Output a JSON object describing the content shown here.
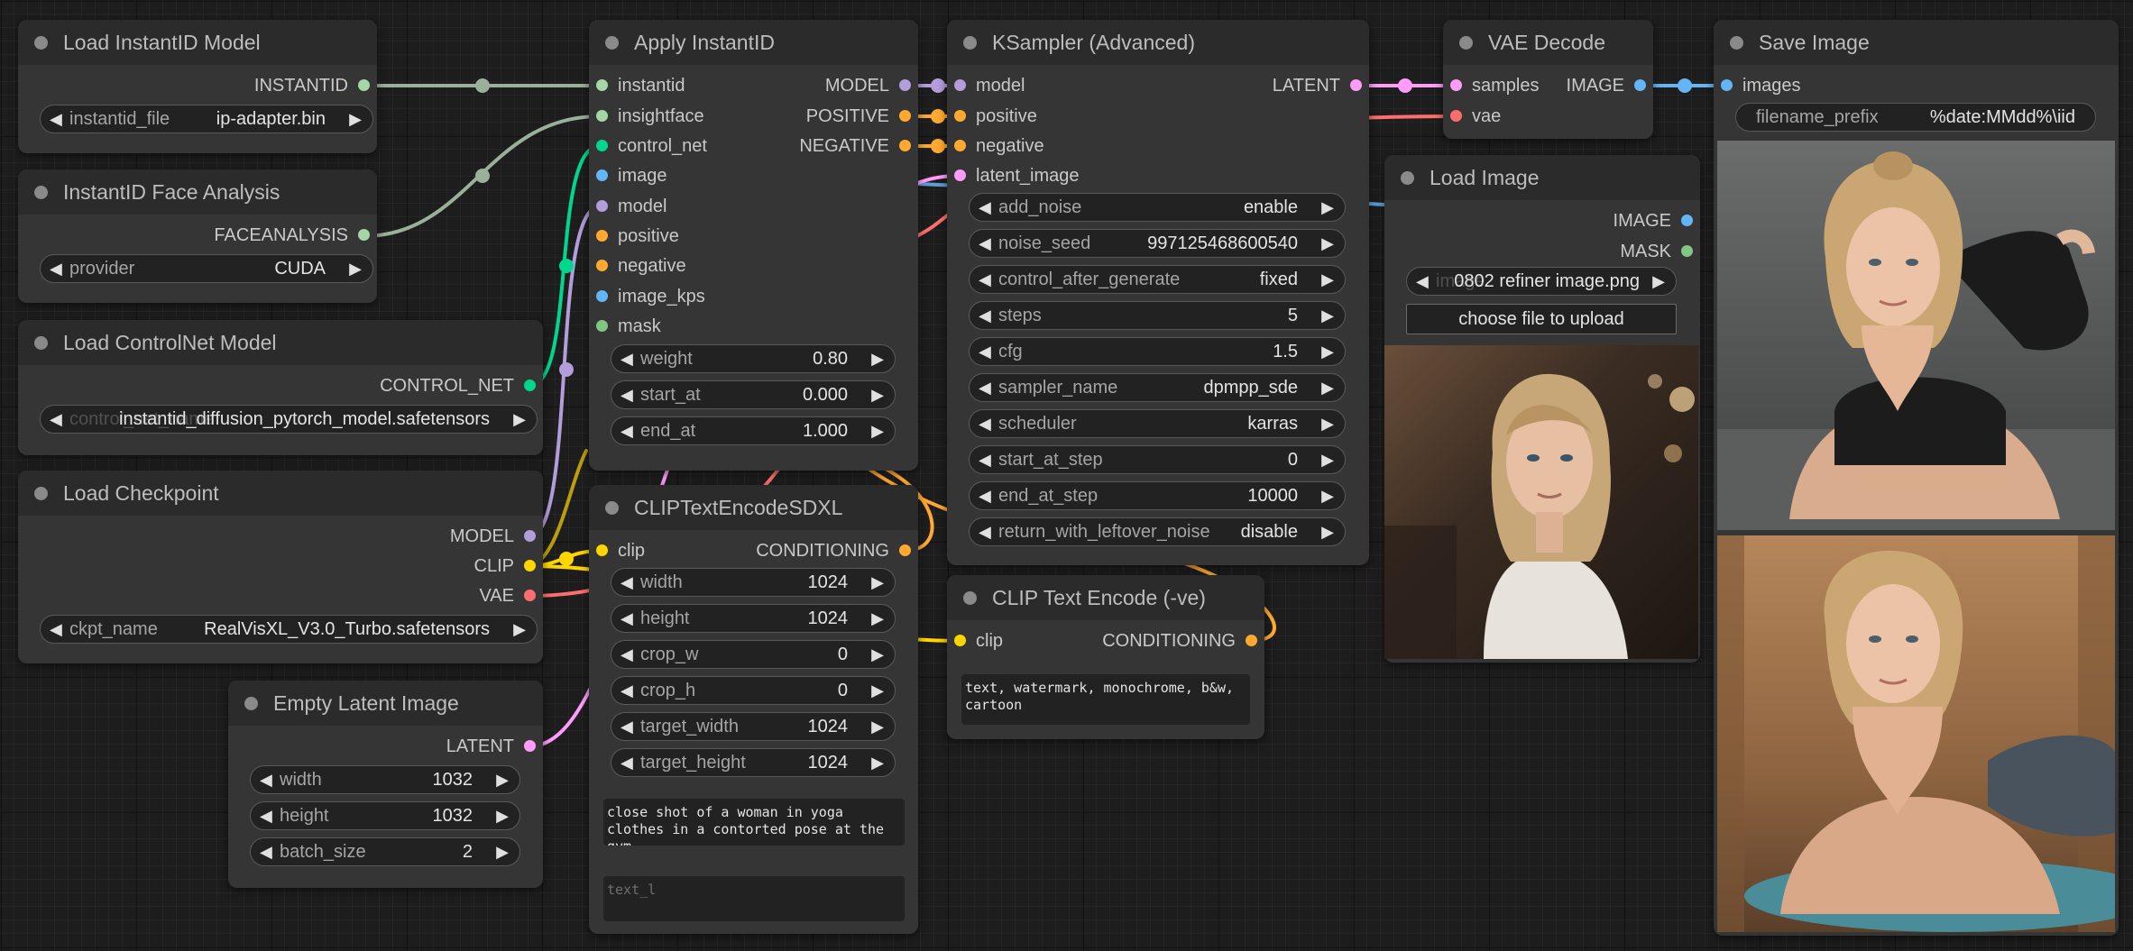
{
  "colors": {
    "model": "#b39ddb",
    "clip": "#ffd500",
    "vae": "#ff6e6e",
    "conditioning": "#ffa931",
    "latent": "#ff9cf9",
    "image": "#64b5f6",
    "mask": "#81c784",
    "instantid": "#a5d6a7",
    "controlnet": "#00d78d",
    "wire_green": "#9bb09b"
  },
  "nodes": {
    "load_instantid": {
      "title": "Load InstantID Model",
      "out": "INSTANTID",
      "widgets": [
        {
          "label": "instantid_file",
          "value": "ip-adapter.bin"
        }
      ]
    },
    "face_analysis": {
      "title": "InstantID Face Analysis",
      "out": "FACEANALYSIS",
      "widgets": [
        {
          "label": "provider",
          "value": "CUDA"
        }
      ]
    },
    "load_controlnet": {
      "title": "Load ControlNet Model",
      "out": "CONTROL_NET",
      "widgets": [
        {
          "label": "control_net_name",
          "value": "instantid_diffusion_pytorch_model.safetensors"
        }
      ]
    },
    "load_checkpoint": {
      "title": "Load Checkpoint",
      "outs": [
        "MODEL",
        "CLIP",
        "VAE"
      ],
      "widgets": [
        {
          "label": "ckpt_name",
          "value": "RealVisXL_V3.0_Turbo.safetensors"
        }
      ]
    },
    "empty_latent": {
      "title": "Empty Latent Image",
      "out": "LATENT",
      "widgets": [
        {
          "label": "width",
          "value": "1032"
        },
        {
          "label": "height",
          "value": "1032"
        },
        {
          "label": "batch_size",
          "value": "2"
        }
      ]
    },
    "apply_instantid": {
      "title": "Apply InstantID",
      "inputs": [
        "instantid",
        "insightface",
        "control_net",
        "image",
        "model",
        "positive",
        "negative",
        "image_kps",
        "mask"
      ],
      "outs": [
        "MODEL",
        "POSITIVE",
        "NEGATIVE"
      ],
      "widgets": [
        {
          "label": "weight",
          "value": "0.80"
        },
        {
          "label": "start_at",
          "value": "0.000"
        },
        {
          "label": "end_at",
          "value": "1.000"
        }
      ]
    },
    "clip_sdxl": {
      "title": "CLIPTextEncodeSDXL",
      "inputs": [
        "clip"
      ],
      "out": "CONDITIONING",
      "widgets": [
        {
          "label": "width",
          "value": "1024"
        },
        {
          "label": "height",
          "value": "1024"
        },
        {
          "label": "crop_w",
          "value": "0"
        },
        {
          "label": "crop_h",
          "value": "0"
        },
        {
          "label": "target_width",
          "value": "1024"
        },
        {
          "label": "target_height",
          "value": "1024"
        }
      ],
      "text_g": "close shot of a woman in yoga clothes in a contorted pose at the gym",
      "text_l_placeholder": "text_l"
    },
    "ksampler": {
      "title": "KSampler (Advanced)",
      "inputs": [
        "model",
        "positive",
        "negative",
        "latent_image"
      ],
      "out": "LATENT",
      "widgets": [
        {
          "label": "add_noise",
          "value": "enable"
        },
        {
          "label": "noise_seed",
          "value": "997125468600540"
        },
        {
          "label": "control_after_generate",
          "value": "fixed"
        },
        {
          "label": "steps",
          "value": "5"
        },
        {
          "label": "cfg",
          "value": "1.5"
        },
        {
          "label": "sampler_name",
          "value": "dpmpp_sde"
        },
        {
          "label": "scheduler",
          "value": "karras"
        },
        {
          "label": "start_at_step",
          "value": "0"
        },
        {
          "label": "end_at_step",
          "value": "10000"
        },
        {
          "label": "return_with_leftover_noise",
          "value": "disable"
        }
      ]
    },
    "clip_neg": {
      "title": "CLIP Text Encode (-ve)",
      "inputs": [
        "clip"
      ],
      "out": "CONDITIONING",
      "text": "text, watermark, monochrome, b&w, cartoon"
    },
    "vae_decode": {
      "title": "VAE Decode",
      "inputs": [
        "samples",
        "vae"
      ],
      "out": "IMAGE"
    },
    "load_image": {
      "title": "Load Image",
      "outs": [
        "IMAGE",
        "MASK"
      ],
      "image_label": "image",
      "image_value": "0802 refiner image.png",
      "upload_label": "choose file to upload"
    },
    "save_image": {
      "title": "Save Image",
      "inputs": [
        "images"
      ],
      "widget": {
        "label": "filename_prefix",
        "value": "%date:MMdd%\\iid"
      }
    }
  }
}
